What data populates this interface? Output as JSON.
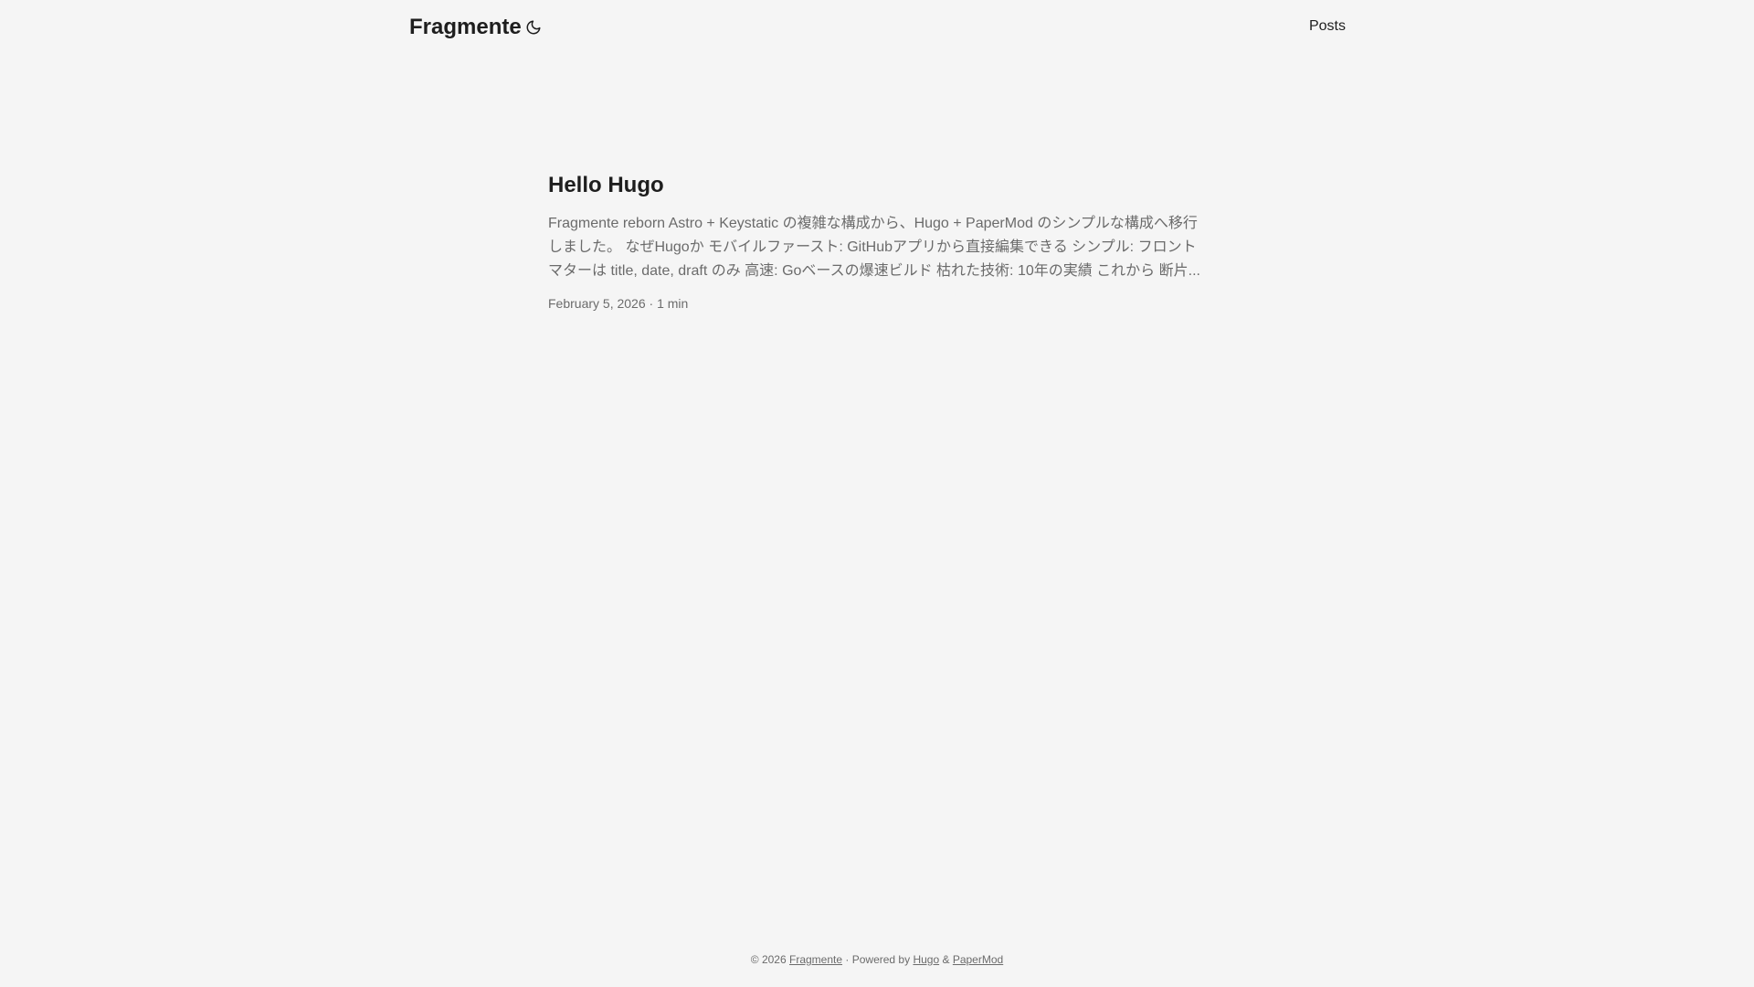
{
  "header": {
    "logo": "Fragmente",
    "theme_toggle_icon": "moon-icon",
    "nav": [
      {
        "label": "Posts"
      }
    ]
  },
  "post": {
    "title": "Hello Hugo",
    "summary": "Fragmente reborn Astro + Keystatic の複雑な構成から、Hugo + PaperMod のシンプルな構成へ移行しました。 なぜHugoか モバイルファースト: GitHubアプリから直接編集できる シンプル: フロントマターは title, date, draft のみ 高速: Goベースの爆速ビルド 枯れた技術: 10年の実績 これから 断片...",
    "date": "February 5, 2026",
    "separator": "·",
    "reading_time": "1 min"
  },
  "footer": {
    "copyright": "© 2026",
    "site_link": "Fragmente",
    "separator": "·",
    "powered_by": "Powered by",
    "hugo_link": "Hugo",
    "and": "&",
    "theme_link": "PaperMod"
  },
  "colors": {
    "background": "#f5f5f5",
    "primary_text": "#1e1e1e",
    "secondary_text": "#6b6b6b"
  }
}
